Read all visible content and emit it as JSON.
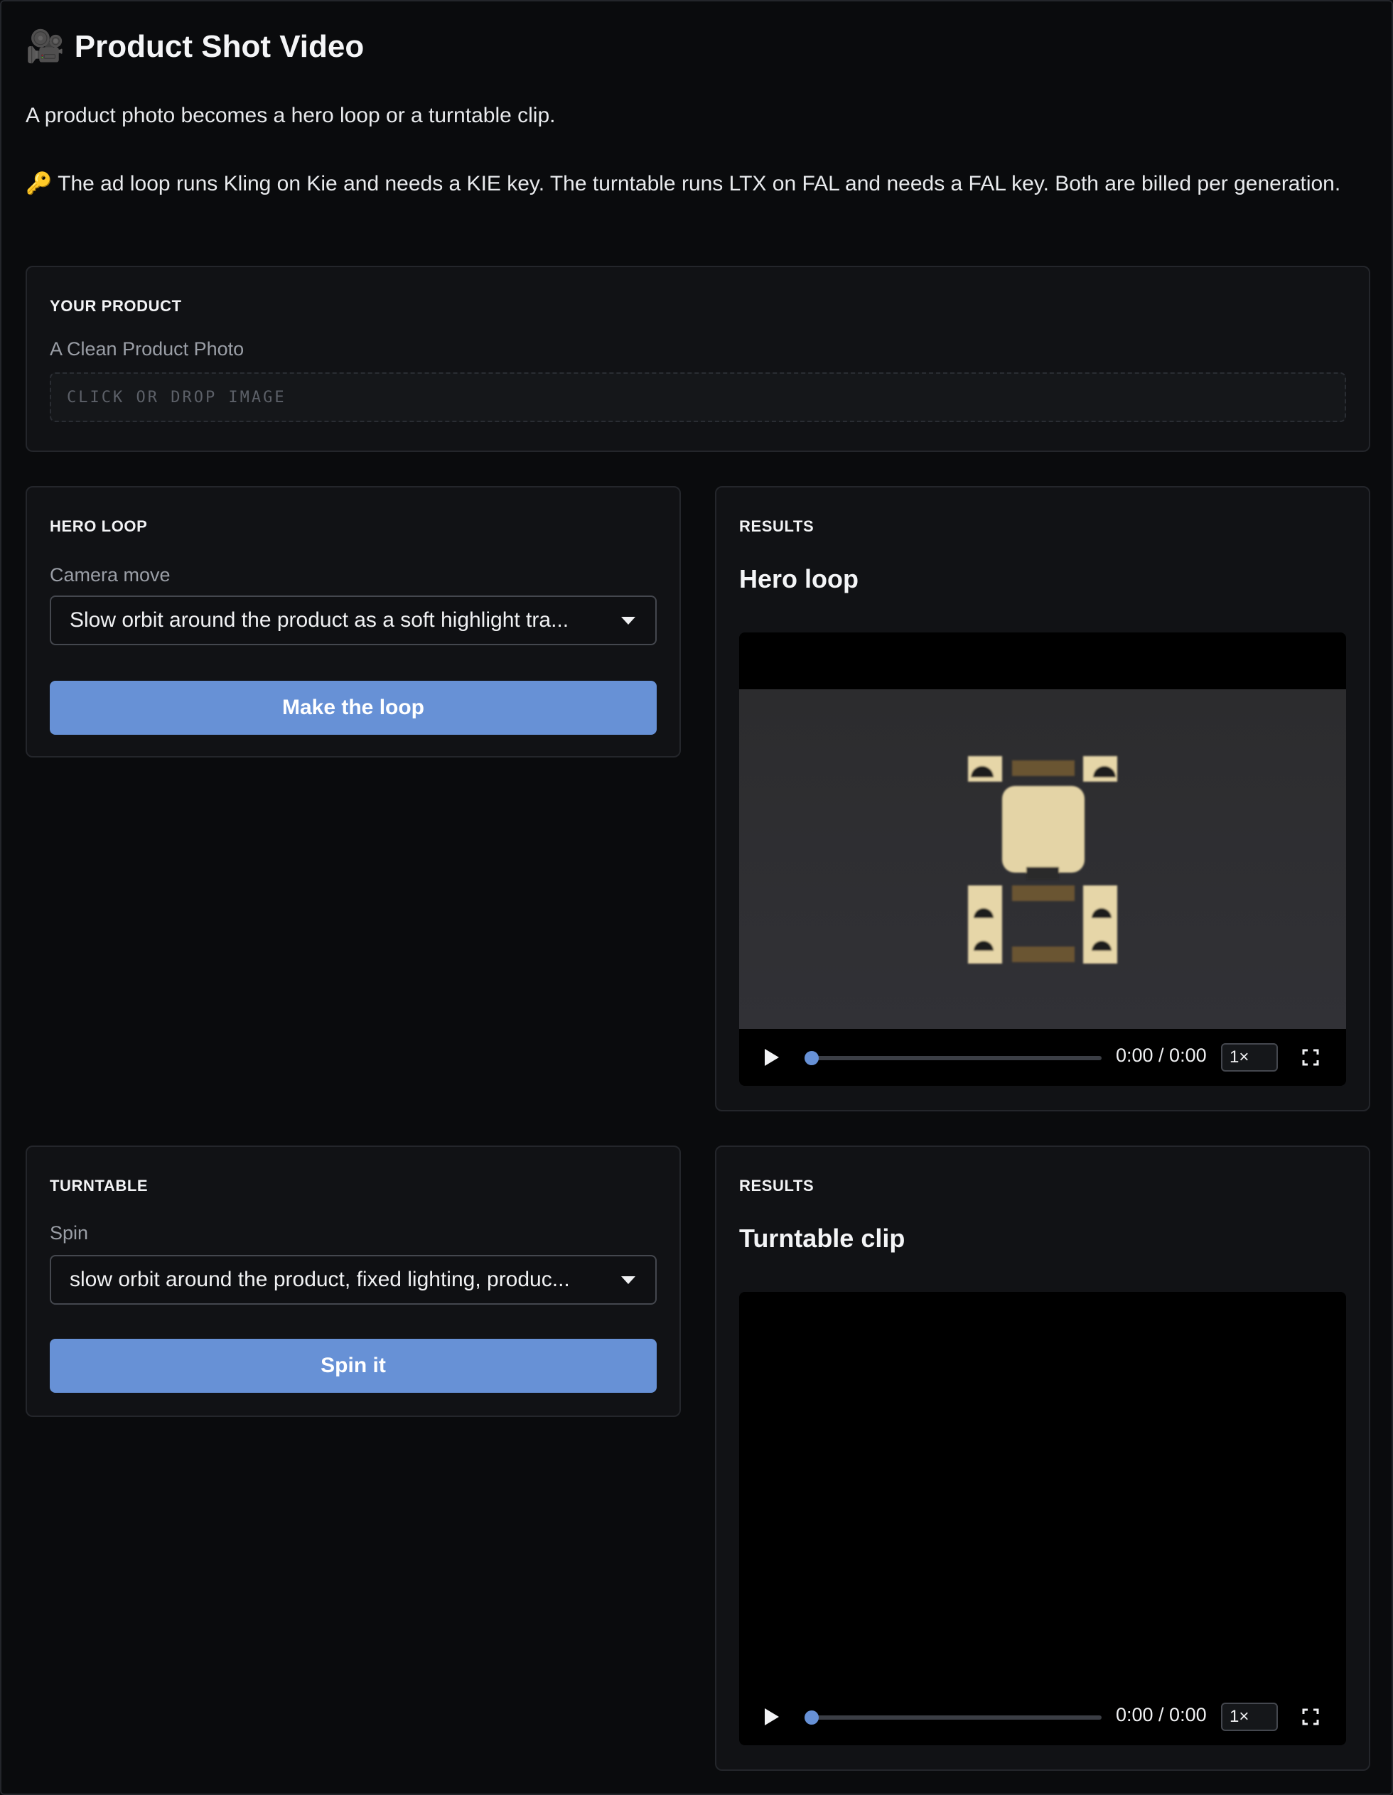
{
  "header": {
    "icon": "movie-camera-icon",
    "emoji": "🎥",
    "title": "Product Shot Video"
  },
  "intro": "A product photo becomes a hero loop or a turntable clip.",
  "note": {
    "icon": "key-icon",
    "emoji": "🔑",
    "text": "The ad loop runs Kling on Kie and needs a KIE key. The turntable runs LTX on FAL and needs a FAL key. Both are billed per generation."
  },
  "product": {
    "section_label": "YOUR PRODUCT",
    "field_label": "A Clean Product Photo",
    "dropzone_text": "CLICK OR DROP IMAGE"
  },
  "hero": {
    "section_label": "HERO LOOP",
    "field_label": "Camera move",
    "select_value": "Slow orbit around the product as a soft highlight tra...",
    "button_label": "Make the loop"
  },
  "hero_results": {
    "section_label": "RESULTS",
    "title": "Hero loop",
    "time": "0:00 / 0:00",
    "speed": "1×"
  },
  "turntable": {
    "section_label": "TURNTABLE",
    "field_label": "Spin",
    "select_value": "slow orbit around the product, fixed lighting, produc...",
    "button_label": "Spin it"
  },
  "turntable_results": {
    "section_label": "RESULTS",
    "title": "Turntable clip",
    "time": "0:00 / 0:00",
    "speed": "1×"
  },
  "colors": {
    "accent": "#6791d6",
    "background": "#0a0b0d",
    "panel": "#111215"
  }
}
